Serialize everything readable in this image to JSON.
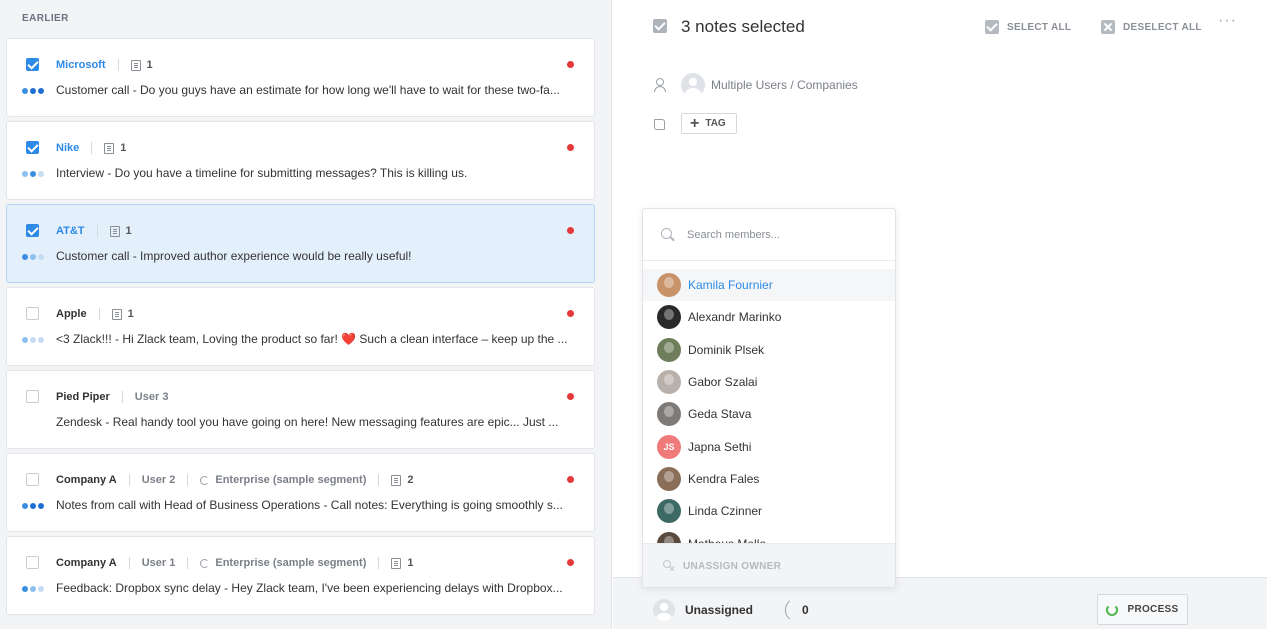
{
  "list": {
    "section_label": "EARLIER",
    "notes": [
      {
        "checked": true,
        "active": false,
        "company": "Microsoft",
        "company_link": true,
        "fields": [
          {
            "type": "doc",
            "text": "1"
          }
        ],
        "text": "Customer call - Do you guys have an estimate for how long we'll have to wait for these two-fa...",
        "dots": [
          "f2",
          "f3",
          "f3"
        ]
      },
      {
        "checked": true,
        "active": false,
        "company": "Nike",
        "company_link": true,
        "fields": [
          {
            "type": "doc",
            "text": "1"
          }
        ],
        "text": "Interview - Do you have a timeline for submitting messages? This is killing us.",
        "dots": [
          "f1",
          "f2",
          "e"
        ]
      },
      {
        "checked": true,
        "active": true,
        "company": "AT&T",
        "company_link": true,
        "fields": [
          {
            "type": "doc",
            "text": "1"
          }
        ],
        "text": "Customer call - Improved author experience would be really useful!",
        "dots": [
          "f2",
          "f1",
          "e"
        ]
      },
      {
        "checked": false,
        "active": false,
        "company": "Apple",
        "company_link": false,
        "fields": [
          {
            "type": "doc",
            "text": "1"
          }
        ],
        "text": "<3 Zlack!!! - Hi Zlack team, Loving the product so far! ❤️ Such a clean interface – keep up the ...",
        "dots": [
          "f1",
          "e",
          "e"
        ]
      },
      {
        "checked": false,
        "active": false,
        "company": "Pied Piper",
        "company_link": false,
        "fields": [
          {
            "type": "user",
            "text": "User 3"
          }
        ],
        "text": "Zendesk - Real handy tool you have going on here! New messaging features are epic... Just ...",
        "dots": []
      },
      {
        "checked": false,
        "active": false,
        "company": "Company A",
        "company_link": false,
        "fields": [
          {
            "type": "user",
            "text": "User 2"
          },
          {
            "type": "segment",
            "text": "Enterprise (sample segment)"
          },
          {
            "type": "doc",
            "text": "2"
          }
        ],
        "text": "Notes from call with Head of Business Operations - Call notes: Everything is going smoothly s...",
        "dots": [
          "f2",
          "f3",
          "f3"
        ]
      },
      {
        "checked": false,
        "active": false,
        "company": "Company A",
        "company_link": false,
        "fields": [
          {
            "type": "user",
            "text": "User 1"
          },
          {
            "type": "segment",
            "text": "Enterprise (sample segment)"
          },
          {
            "type": "doc",
            "text": "1"
          }
        ],
        "text": "Feedback: Dropbox sync delay - Hey Zlack team, I've been experiencing delays with Dropbox...",
        "dots": [
          "f2",
          "f1",
          "e"
        ]
      }
    ]
  },
  "header": {
    "title": "3 notes selected",
    "select_all": "SELECT ALL",
    "deselect_all": "DESELECT ALL",
    "more": "···"
  },
  "details": {
    "owner_text": "Multiple Users / Companies",
    "tag_label": "TAG"
  },
  "dropdown": {
    "search_placeholder": "Search members...",
    "members": [
      {
        "name": "Kamila Fournier",
        "highlight": true,
        "color": "#c8926a"
      },
      {
        "name": "Alexandr Marinko",
        "highlight": false,
        "color": "#2a2a2a"
      },
      {
        "name": "Dominik Plsek",
        "highlight": false,
        "color": "#6e7d5a"
      },
      {
        "name": "Gabor Szalai",
        "highlight": false,
        "color": "#b8b0aa"
      },
      {
        "name": "Geda Stava",
        "highlight": false,
        "color": "#7d7a78"
      },
      {
        "name": "Japna Sethi",
        "highlight": false,
        "color": "#f07a7a",
        "initials": "JS"
      },
      {
        "name": "Kendra Fales",
        "highlight": false,
        "color": "#8a6e58"
      },
      {
        "name": "Linda Czinner",
        "highlight": false,
        "color": "#3e6a66"
      },
      {
        "name": "Matheus Mello",
        "highlight": false,
        "color": "#5a4a3e"
      }
    ],
    "unassign_label": "UNASSIGN OWNER"
  },
  "footer": {
    "owner": "Unassigned",
    "count": "0",
    "process_label": "PROCESS"
  }
}
